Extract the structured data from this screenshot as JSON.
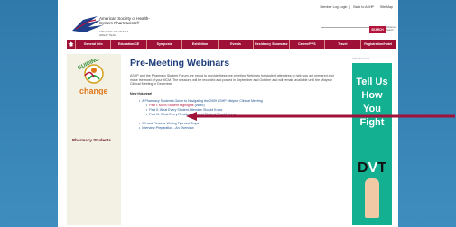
{
  "header": {
    "logo_name": "American Society of Health-System Pharmacists®",
    "logo_tag": "CREATING WE MAKE A GREAT TEAM",
    "top_links": [
      "Member Log Login",
      "|",
      "Back to ASHP",
      "|",
      "Site Map"
    ],
    "search_placeholder": "",
    "search_button": "SEARCH",
    "advanced_search": "Advanced Search"
  },
  "nav": {
    "items": [
      "General Info",
      "Education/CE",
      "Symposia",
      "Exhibition",
      "Events",
      "Residency Showcase",
      "Career/PPS",
      "Travel",
      "Registration/Hotel"
    ]
  },
  "sidebar": {
    "badge_top": "GUIDING",
    "badge_bottom": "change",
    "link": "Pharmacy Students"
  },
  "main": {
    "title": "Pre-Meeting Webinars",
    "intro": "ASHP and the Pharmacy Student Forum are proud to provide these pre-meeting Webinars for student attendees to help you get prepared and make the most of your MCM. The sessions will be recorded and posted in September and October and will remain available until the Midyear Clinical Meeting in December.",
    "new_label": "New this year!",
    "list": {
      "item1": "A Pharmacy Student's Guide to Navigating the 2009 ASHP Midyear Clinical Meeting",
      "sub1": "Part I: MCM Student Highlights",
      "sub1_note": "(video)",
      "sub2": "Part II: What Every Student Attendee Should Know",
      "sub3": "Part III: What Every Residency Bound Student Should Know",
      "item2": "CV and Resume Writing Tips and Traps",
      "item3": "Interview Preparation - An Overview"
    }
  },
  "ad": {
    "label": "Advertisement",
    "line1": "Tell Us",
    "line2": "How",
    "line3": "You",
    "line4": "Fight",
    "dvt_d": "D",
    "dvt_v": "V",
    "dvt_t": "T"
  },
  "colors": {
    "brand": "#9e1036",
    "title_blue": "#1e3d7a",
    "link_blue": "#1a4f8f",
    "ad_teal": "#14b092",
    "background": "#3a7fae"
  }
}
